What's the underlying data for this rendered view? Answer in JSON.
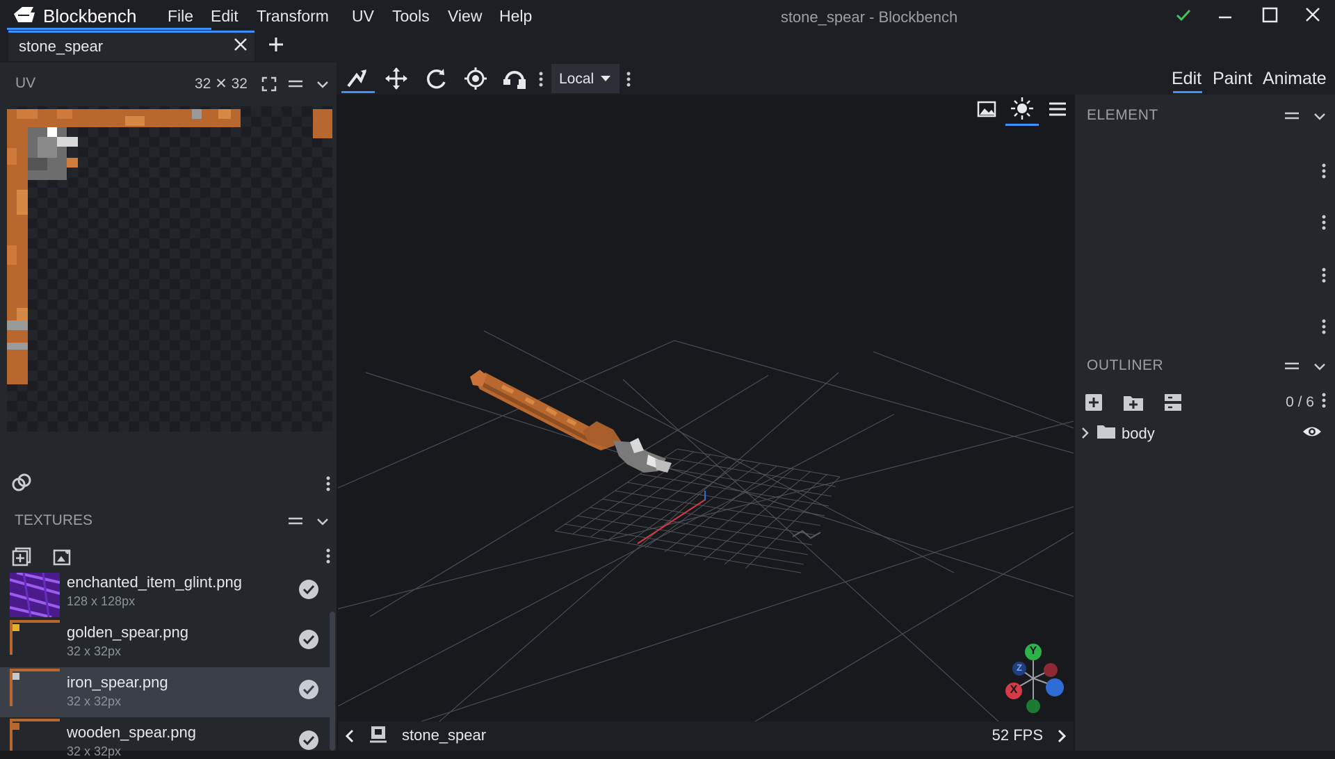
{
  "app": {
    "brand": "Blockbench",
    "window_title": "stone_spear - Blockbench",
    "menu": [
      "File",
      "Edit",
      "Transform",
      "UV",
      "Tools",
      "View",
      "Help"
    ]
  },
  "tabs": {
    "active": "stone_spear",
    "add_icon": "plus-icon",
    "close_icon": "close-icon"
  },
  "uv_panel": {
    "title": "UV",
    "size": "32 ✕ 32"
  },
  "textures_panel": {
    "title": "TEXTURES",
    "items": [
      {
        "name": "enchanted_item_glint.png",
        "size": "128 x 128px",
        "selected": false
      },
      {
        "name": "golden_spear.png",
        "size": "32 x 32px",
        "selected": false
      },
      {
        "name": "iron_spear.png",
        "size": "32 x 32px",
        "selected": true
      },
      {
        "name": "wooden_spear.png",
        "size": "32 x 32px",
        "selected": false
      }
    ]
  },
  "toolbar": {
    "tools": [
      "move-tool-icon",
      "move-icon",
      "rotate-icon",
      "pivot-icon",
      "vertex-snap-icon"
    ],
    "space_select": "Local"
  },
  "modes": [
    "Edit",
    "Paint",
    "Animate"
  ],
  "active_mode": "Edit",
  "element_panel": {
    "title": "ELEMENT"
  },
  "outliner": {
    "title": "OUTLINER",
    "count": "0 / 6",
    "groups": [
      {
        "name": "body",
        "visible": true
      }
    ]
  },
  "viewport": {
    "model_name": "stone_spear",
    "fps": "52 FPS",
    "gizmo": {
      "x": "X",
      "y": "Y",
      "z": "Z"
    }
  },
  "colors": {
    "accent": "#3e90ff",
    "success": "#45c35c",
    "spear_wood": "#b8682f",
    "axis_x": "#d63a47",
    "axis_y": "#2bb34a",
    "axis_z": "#2f6cd6"
  }
}
